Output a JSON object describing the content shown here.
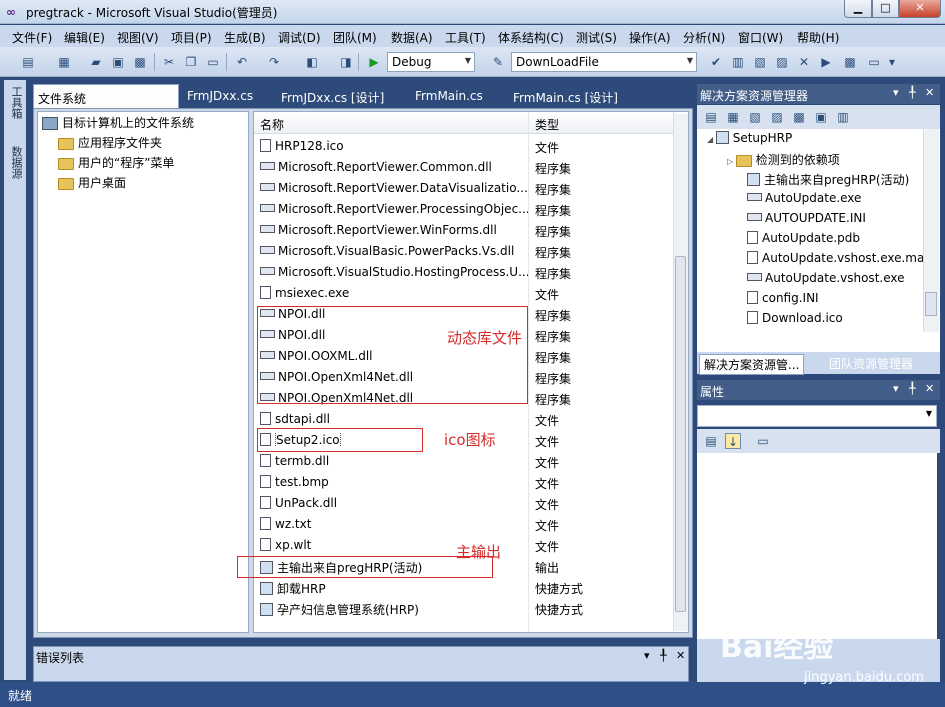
{
  "window": {
    "title": "pregtrack - Microsoft Visual Studio(管理员)"
  },
  "menu": [
    "文件(F)",
    "编辑(E)",
    "视图(V)",
    "项目(P)",
    "生成(B)",
    "调试(D)",
    "团队(M)",
    "数据(A)",
    "工具(T)",
    "体系结构(C)",
    "测试(S)",
    "操作(A)",
    "分析(N)",
    "窗口(W)",
    "帮助(H)"
  ],
  "toolbar": {
    "config": "Debug",
    "target": "DownLoadFile"
  },
  "left_strip": {
    "toolbox": "工具箱",
    "datasource": "数据源"
  },
  "tabs": [
    "文件系统 (SetupHRP)",
    "FrmJDxx.cs",
    "FrmJDxx.cs [设计]",
    "FrmMain.cs",
    "FrmMain.cs [设计]"
  ],
  "tree": {
    "root": "目标计算机上的文件系统",
    "items": [
      "应用程序文件夹",
      "用户的“程序”菜单",
      "用户桌面"
    ]
  },
  "list": {
    "headers": {
      "name": "名称",
      "type": "类型"
    },
    "rows": [
      {
        "name": "HRP128.ico",
        "type": "文件"
      },
      {
        "name": "Microsoft.ReportViewer.Common.dll",
        "type": "程序集"
      },
      {
        "name": "Microsoft.ReportViewer.DataVisualizatio...",
        "type": "程序集"
      },
      {
        "name": "Microsoft.ReportViewer.ProcessingObjec...",
        "type": "程序集"
      },
      {
        "name": "Microsoft.ReportViewer.WinForms.dll",
        "type": "程序集"
      },
      {
        "name": "Microsoft.VisualBasic.PowerPacks.Vs.dll",
        "type": "程序集"
      },
      {
        "name": "Microsoft.VisualStudio.HostingProcess.U...",
        "type": "程序集"
      },
      {
        "name": "msiexec.exe",
        "type": "文件"
      },
      {
        "name": "NPOI.dll",
        "type": "程序集"
      },
      {
        "name": "NPOI.dll",
        "type": "程序集"
      },
      {
        "name": "NPOI.OOXML.dll",
        "type": "程序集"
      },
      {
        "name": "NPOI.OpenXml4Net.dll",
        "type": "程序集"
      },
      {
        "name": "NPOI.OpenXml4Net.dll",
        "type": "程序集"
      },
      {
        "name": "sdtapi.dll",
        "type": "文件"
      },
      {
        "name": "Setup2.ico",
        "type": "文件"
      },
      {
        "name": "termb.dll",
        "type": "文件"
      },
      {
        "name": "test.bmp",
        "type": "文件"
      },
      {
        "name": "UnPack.dll",
        "type": "文件"
      },
      {
        "name": "wz.txt",
        "type": "文件"
      },
      {
        "name": "xp.wlt",
        "type": "文件"
      },
      {
        "name": "主输出来自pregHRP(活动)",
        "type": "输出"
      },
      {
        "name": "卸载HRP",
        "type": "快捷方式"
      },
      {
        "name": "孕产妇信息管理系统(HRP)",
        "type": "快捷方式"
      }
    ]
  },
  "annotations": {
    "dll": "动态库文件",
    "ico": "ico图标",
    "output": "主输出"
  },
  "error_list": {
    "title": "错误列表"
  },
  "status": "就绪",
  "solution_explorer": {
    "title": "解决方案资源管理器",
    "items": [
      "SetupHRP",
      "检测到的依赖项",
      "主输出来自pregHRP(活动)",
      "AutoUpdate.exe",
      "AUTOUPDATE.INI",
      "AutoUpdate.pdb",
      "AutoUpdate.vshost.exe.ma",
      "AutoUpdate.vshost.exe",
      "config.INI",
      "Download.ico"
    ],
    "tabs": [
      "解决方案资源管...",
      "团队资源管理器"
    ]
  },
  "properties": {
    "title": "属性"
  },
  "watermark": {
    "brand": "Bai经验",
    "url": "jingyan.baidu.com"
  }
}
